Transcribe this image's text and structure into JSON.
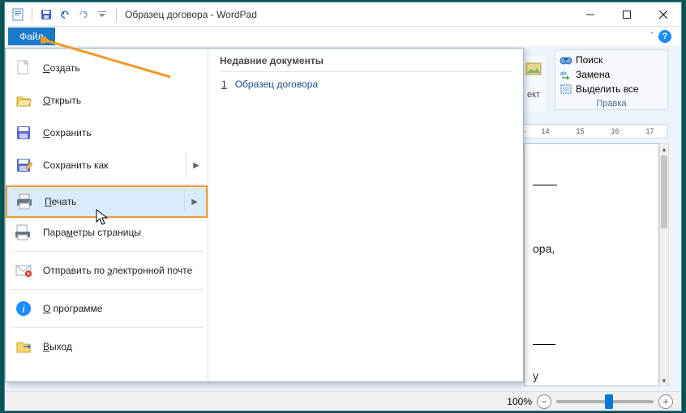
{
  "title": "Образец договора - WordPad",
  "file_tab": "Файл",
  "editing_group": {
    "find": "Поиск",
    "replace": "Замена",
    "select_all": "Выделить все",
    "label": "Правка"
  },
  "peek_group_label": "ект",
  "ruler_ticks": [
    "14",
    "15",
    "16",
    "17"
  ],
  "doc_peek_lines": [
    "ора,",
    "",
    "",
    "",
    "",
    "у"
  ],
  "file_menu": {
    "items": [
      {
        "label": "Создать"
      },
      {
        "label": "Открыть"
      },
      {
        "label": "Сохранить"
      },
      {
        "label": "Сохранить как",
        "arrow": true
      },
      {
        "label": "Печать",
        "arrow": true,
        "highlight": true
      },
      {
        "label": "Параметры страницы"
      },
      {
        "label": "Отправить по электронной почте"
      },
      {
        "label": "О программе"
      },
      {
        "label": "Выход"
      }
    ],
    "recent_title": "Недавние документы",
    "recent": [
      {
        "num": "1",
        "label": "Образец договора"
      }
    ]
  },
  "status": {
    "zoom": "100%"
  }
}
